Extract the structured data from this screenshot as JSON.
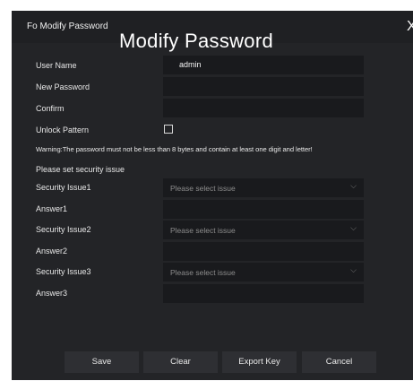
{
  "window": {
    "title": "Fo Modify Password",
    "heading": "Modify Password",
    "close_glyph": "X"
  },
  "form": {
    "username_label": "User Name",
    "username_value": "admin",
    "new_password_label": "New Password",
    "confirm_label": "Confirm",
    "unlock_pattern_label": "Unlock Pattern",
    "unlock_pattern_checked": false,
    "warning": "Warning:The password must not be less than 8 bytes and contain at least one digit and letter!",
    "security_heading": "Please set security issue",
    "security_issue1_label": "Security Issue1",
    "answer1_label": "Answer1",
    "security_issue2_label": "Security Issue2",
    "answer2_label": "Answer2",
    "security_issue3_label": "Security Issue3",
    "answer3_label": "Answer3",
    "select_placeholder": "Please select issue",
    "chevron_icon": "chevron-down-icon"
  },
  "buttons": {
    "save": "Save",
    "clear": "Clear",
    "export_key": "Export Key",
    "cancel": "Cancel"
  },
  "colors": {
    "dialog_bg": "#232427",
    "field_bg": "#191a1d",
    "button_bg": "#2e2f33",
    "placeholder": "#8c8c8c"
  }
}
